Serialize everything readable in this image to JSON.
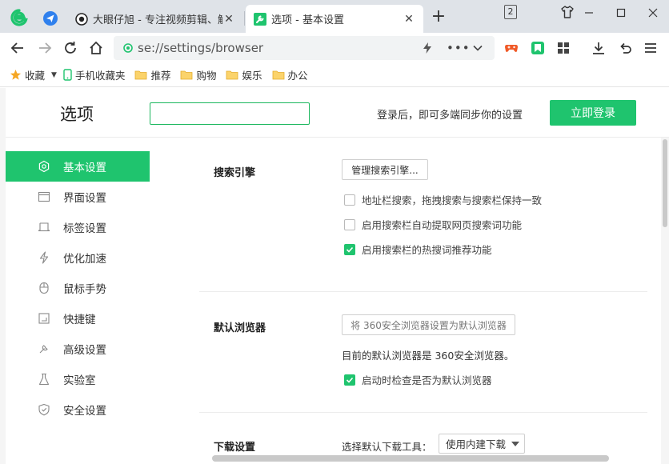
{
  "tabs": [
    {
      "title": "大眼仔旭 - 专注视频剪辑、解说...",
      "active": false,
      "favicon": "eye-favicon-icon"
    },
    {
      "title": "选项 - 基本设置",
      "active": true,
      "favicon": "wrench-favicon-icon"
    }
  ],
  "window": {
    "tab_count": "2"
  },
  "address": {
    "url": "se://settings/browser"
  },
  "bookmarks": {
    "favorites": "收藏",
    "mobile": "手机收藏夹",
    "folders": [
      "推荐",
      "购物",
      "娱乐",
      "办公"
    ]
  },
  "page": {
    "title": "选项",
    "search_value": "",
    "sync_text": "登录后，即可多端同步你的设置",
    "login_button": "立即登录"
  },
  "sidebar": {
    "items": [
      {
        "label": "基本设置",
        "icon": "gear-icon"
      },
      {
        "label": "界面设置",
        "icon": "window-icon"
      },
      {
        "label": "标签设置",
        "icon": "tab-icon"
      },
      {
        "label": "优化加速",
        "icon": "lightning-icon"
      },
      {
        "label": "鼠标手势",
        "icon": "mouse-icon"
      },
      {
        "label": "快捷键",
        "icon": "keyboard-icon"
      },
      {
        "label": "高级设置",
        "icon": "wrench-icon"
      },
      {
        "label": "实验室",
        "icon": "flask-icon"
      },
      {
        "label": "安全设置",
        "icon": "shield-icon"
      }
    ],
    "active_index": 0
  },
  "search_engine": {
    "title": "搜索引擎",
    "manage_button": "管理搜索引擎...",
    "options": [
      {
        "label": "地址栏搜索，拖拽搜索与搜索栏保持一致",
        "checked": false
      },
      {
        "label": "启用搜索栏自动提取网页搜索词功能",
        "checked": false
      },
      {
        "label": "启用搜索栏的热搜词推荐功能",
        "checked": true
      }
    ]
  },
  "default_browser": {
    "title": "默认浏览器",
    "set_button": "将 360安全浏览器设置为默认浏览器",
    "status": "目前的默认浏览器是 360安全浏览器。",
    "option": {
      "label": "启动时检查是否为默认浏览器",
      "checked": true
    }
  },
  "download": {
    "title": "下载设置",
    "label": "选择默认下载工具：",
    "selected": "使用内建下载"
  },
  "colors": {
    "accent": "#1fc46e",
    "tabstrip": "#dfe3e8"
  }
}
